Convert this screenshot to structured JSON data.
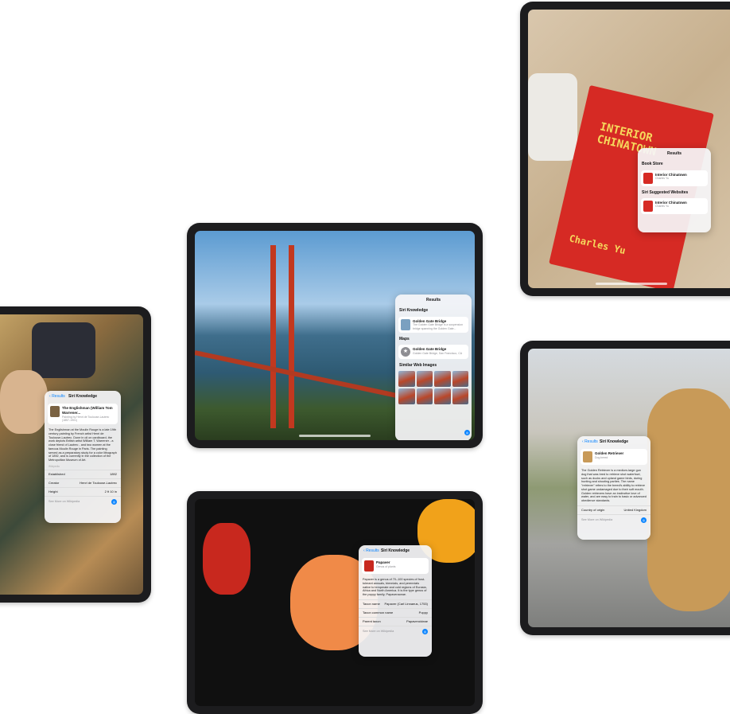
{
  "colors": {
    "accent": "#0a84ff",
    "panel_bg": "#f5f5f7"
  },
  "painting_panel": {
    "back": "Results",
    "title": "Siri Knowledge",
    "item_title": "The Englishman (William Tom Warrener...",
    "item_sub": "Painting by Henri de Toulouse-Lautrec (1857-1901)",
    "body": "The Englishman at the Moulin Rouge is a late 19th century painting by French artist Henri de Toulouse-Lautrec. Done in oil on cardboard, the work depicts British artist William T. Warrener - a close friend of Lautrec - and two women at the famous Moulin Rouge in Paris. The painting served as a preparatory study for a color lithograph of 1892, and is currently in the collection of the Metropolitan Museum of Art.",
    "source": "Wikipedia",
    "rows": [
      {
        "k": "Established",
        "v": "1892"
      },
      {
        "k": "Creator",
        "v": "Henri de Toulouse-Lautrec"
      },
      {
        "k": "Height",
        "v": "2 ft 10 in"
      }
    ],
    "more": "See More on Wikipedia"
  },
  "bridge_panel": {
    "title": "Results",
    "sections": [
      {
        "label": "Siri Knowledge",
        "item_title": "Golden Gate Bridge",
        "item_sub": "The Golden Gate Bridge is a suspension bridge spanning the Golden Gate..."
      },
      {
        "label": "Maps",
        "item_title": "Golden Gate Bridge",
        "item_sub": "Golden Gate Bridge, San Francisco, CA"
      }
    ],
    "images_label": "Similar Web Images"
  },
  "book_panel": {
    "title": "Results",
    "sections": [
      {
        "label": "Book Store",
        "item_title": "Interior Chinatown",
        "item_sub": "Charles Yu"
      },
      {
        "label": "Siri Suggested Websites",
        "item_title": "Interior Chinatown",
        "item_sub": "Charles Yu"
      }
    ]
  },
  "dog_panel": {
    "back": "Results",
    "title": "Siri Knowledge",
    "item_title": "Golden Retriever",
    "item_sub": "Dog breed",
    "body": "The Golden Retriever is a medium-large gun dog that was bred to retrieve shot waterfowl, such as ducks and upland game birds, during hunting and shooting parties. The name \"retriever\" refers to the breed's ability to retrieve shot game undamaged due to their soft mouth. Golden retrievers have an instinctive love of water, and are easy to train to basic or advanced obedience standards.",
    "rows": [
      {
        "k": "Country of origin",
        "v": "United Kingdom"
      }
    ],
    "more": "See More on Wikipedia"
  },
  "flower_panel": {
    "back": "Results",
    "title": "Siri Knowledge",
    "item_title": "Papaver",
    "item_sub": "Genus of plants",
    "body": "Papaver is a genus of 70–100 species of frost-tolerant annuals, biennials, and perennials native to temperate and cold regions of Eurasia, Africa and North America. It is the type genus of the poppy family, Papaveraceae.",
    "rows": [
      {
        "k": "Taxon name",
        "v": "Papaver (Carl Linnaeus, 1753)"
      },
      {
        "k": "Taxon common name",
        "v": "Poppy"
      },
      {
        "k": "Parent taxon",
        "v": "Papaveroideae"
      }
    ],
    "more": "See More on Wikipedia"
  },
  "book_cover": {
    "title": "INTERIOR CHINATOWN",
    "author": "Charles Yu"
  }
}
